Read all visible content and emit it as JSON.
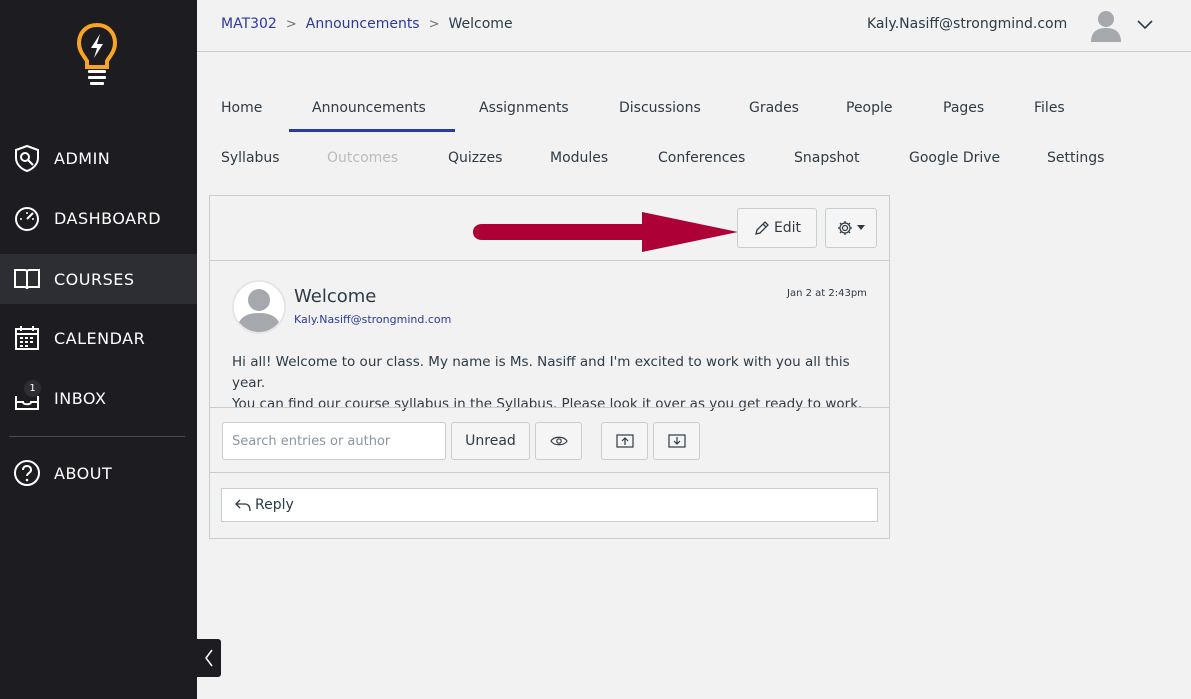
{
  "sidebar": {
    "items": [
      {
        "label": "ADMIN",
        "icon": "shield-icon"
      },
      {
        "label": "DASHBOARD",
        "icon": "speedometer-icon"
      },
      {
        "label": "COURSES",
        "icon": "book-icon",
        "active": true
      },
      {
        "label": "CALENDAR",
        "icon": "calendar-icon"
      },
      {
        "label": "INBOX",
        "icon": "inbox-icon",
        "badge": "1"
      },
      {
        "label": "ABOUT",
        "icon": "question-circle-icon"
      }
    ],
    "colors": {
      "background": "#1d1d21",
      "active": "#2d2e33",
      "logo": "#f6a623"
    }
  },
  "header": {
    "breadcrumb": [
      "MAT302",
      "Announcements",
      "Welcome"
    ],
    "user_email": "Kaly.Nasiff@strongmind.com"
  },
  "tabs": {
    "row1": [
      "Home",
      "Announcements",
      "Assignments",
      "Discussions",
      "Grades",
      "People",
      "Pages",
      "Files"
    ],
    "row2": [
      "Syllabus",
      "Outcomes",
      "Quizzes",
      "Modules",
      "Conferences",
      "Snapshot",
      "Google Drive",
      "Settings"
    ],
    "active": "Announcements",
    "disabled": "Outcomes"
  },
  "announcement": {
    "edit_label": "Edit",
    "title": "Welcome",
    "author": "Kaly.Nasiff@strongmind.com",
    "date": "Jan 2 at 2:43pm",
    "body_line1": "Hi all! Welcome to our class. My name is Ms. Nasiff and I'm excited to work with you all this year.",
    "body_line2": "You can find our course syllabus in the Syllabus. Please look it over as you get ready to work.",
    "search_placeholder": "Search entries or author",
    "unread_label": "Unread",
    "reply_label": "Reply"
  },
  "colors": {
    "accent": "#2b3a9b",
    "arrow": "#ad0037"
  }
}
